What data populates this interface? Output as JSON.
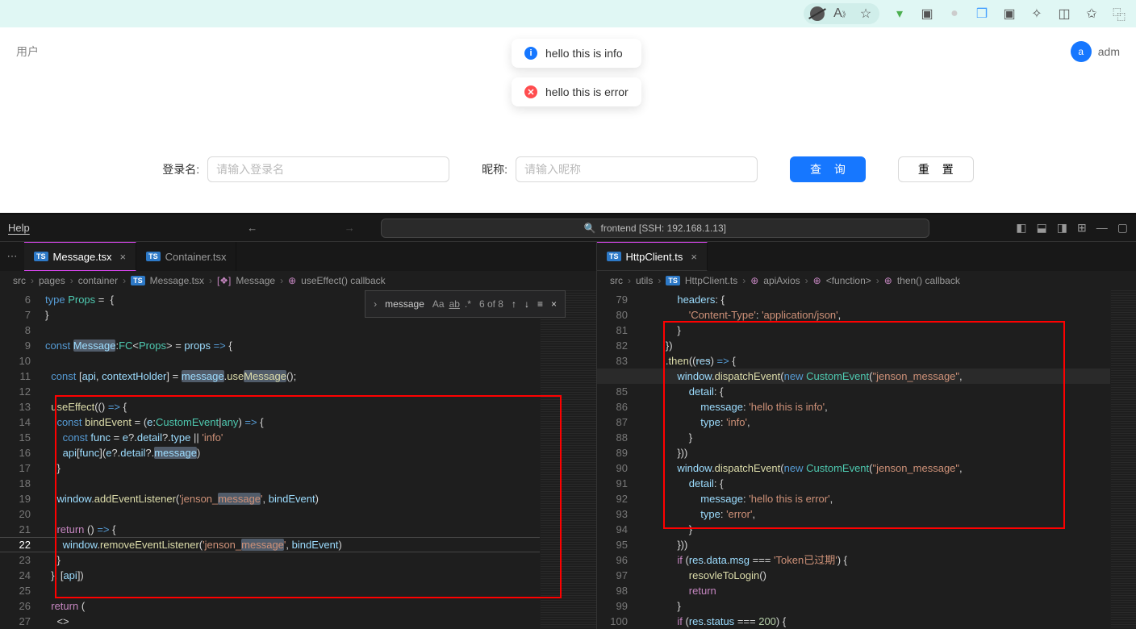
{
  "browser": {
    "user_label": "adm"
  },
  "page": {
    "header": "用户",
    "avatar": "a"
  },
  "toasts": [
    {
      "type": "info",
      "text": "hello this is info"
    },
    {
      "type": "error",
      "text": "hello this is error"
    }
  ],
  "form": {
    "login_label": "登录名:",
    "login_ph": "请输入登录名",
    "nick_label": "昵称:",
    "nick_ph": "请输入昵称",
    "query_btn": "查 询",
    "reset_btn": "重 置"
  },
  "vscode": {
    "help": "Help",
    "search_title": "frontend [SSH: 192.168.1.13]",
    "tabs_left": [
      {
        "label": "Message.tsx",
        "active": true
      },
      {
        "label": "Container.tsx",
        "active": false
      }
    ],
    "tabs_right": [
      {
        "label": "HttpClient.ts",
        "active": true
      }
    ],
    "bc_left": [
      "src",
      "pages",
      "container",
      "Message.tsx",
      "Message",
      "useEffect() callback"
    ],
    "bc_right": [
      "src",
      "utils",
      "HttpClient.ts",
      "apiAxios",
      "<function>",
      "then() callback"
    ],
    "find": {
      "term": "message",
      "count": "6 of 8"
    },
    "left_start": 6,
    "right_start": 79,
    "left_current": 22,
    "right_current": 84
  }
}
